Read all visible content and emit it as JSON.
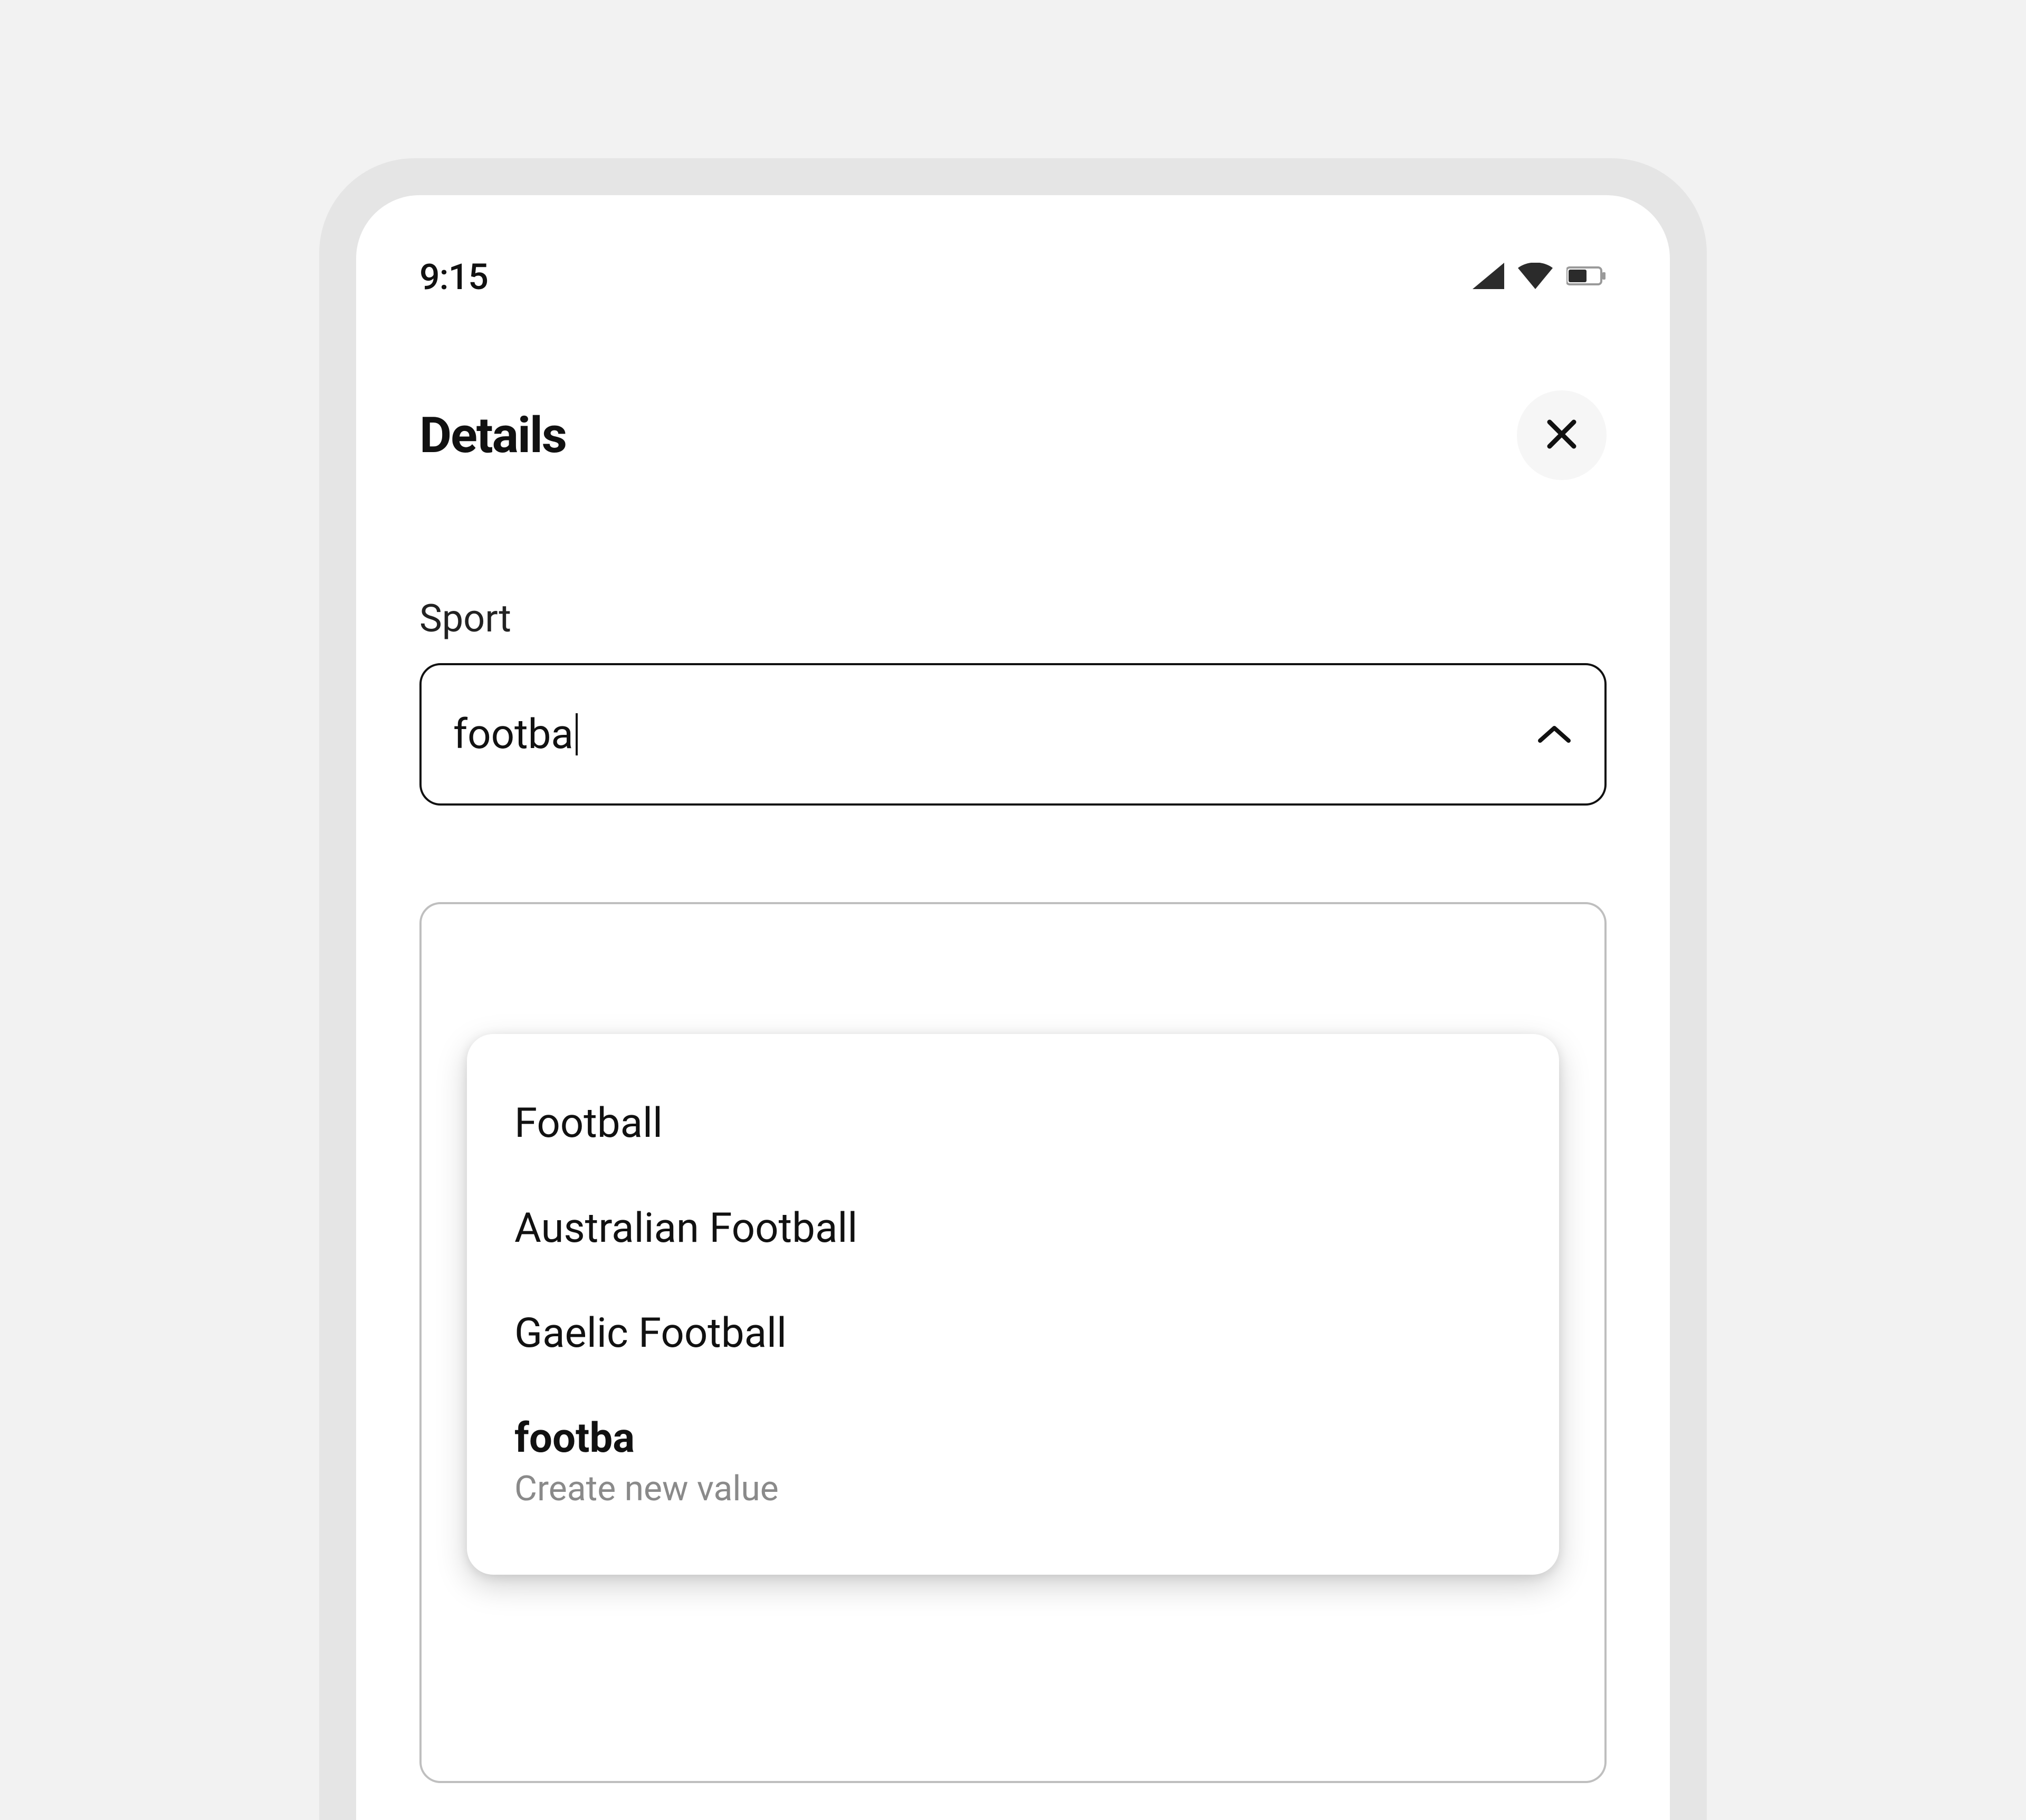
{
  "status": {
    "time": "9:15"
  },
  "header": {
    "title": "Details"
  },
  "field": {
    "label": "Sport",
    "value": "footba"
  },
  "dropdown": {
    "options": [
      "Football",
      "Australian Football",
      "Gaelic Football"
    ],
    "create": {
      "primary": "footba",
      "secondary": "Create new value"
    }
  }
}
